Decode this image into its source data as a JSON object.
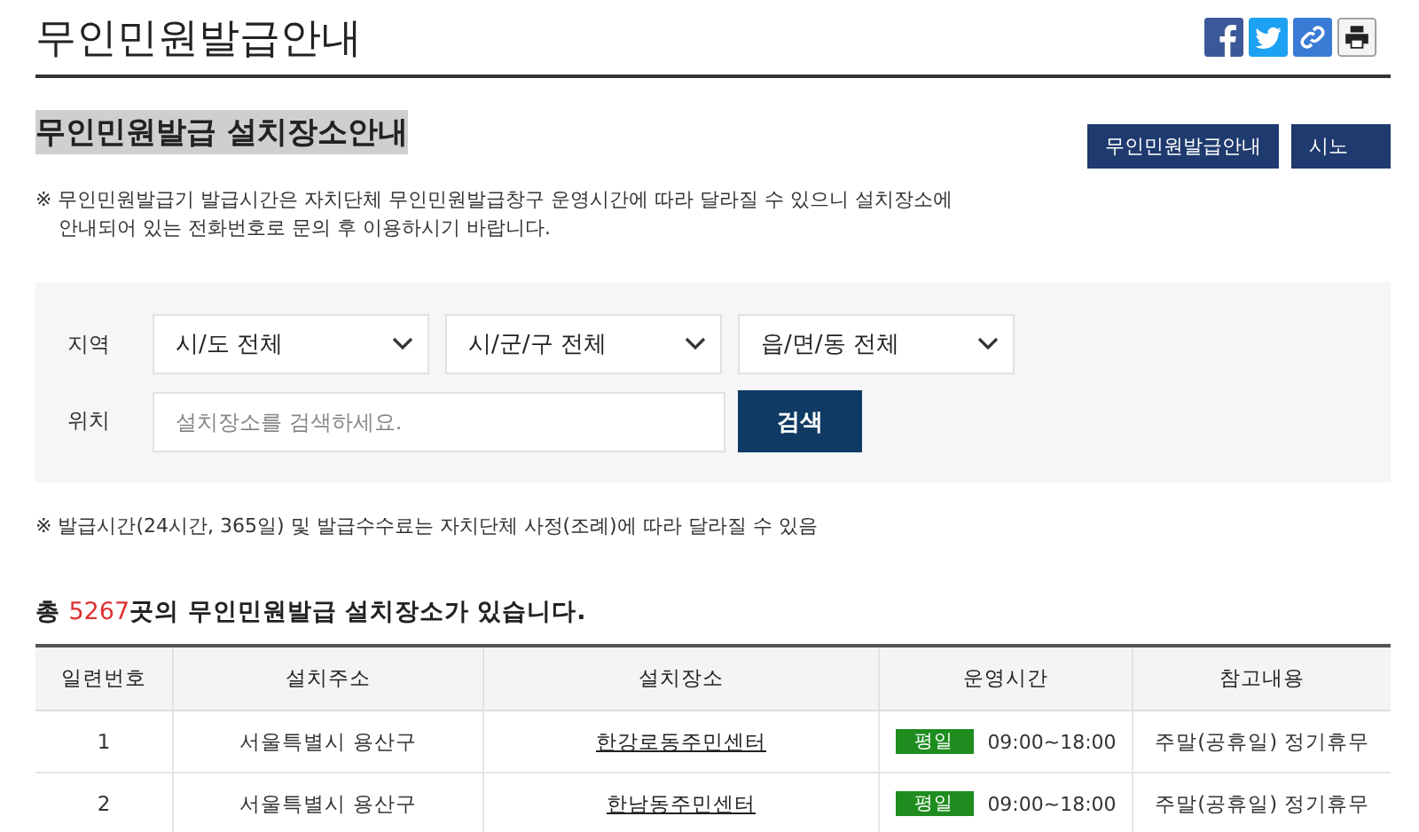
{
  "page_title": "무인민원발급안내",
  "share_icons": [
    {
      "kind": "facebook"
    },
    {
      "kind": "twitter"
    },
    {
      "kind": "link"
    },
    {
      "kind": "print"
    }
  ],
  "section_title": "무인민원발급 설치장소안내",
  "tab_buttons": [
    {
      "label": "무인민원발급안내",
      "selected": false
    },
    {
      "label": "시노",
      "selected": false
    }
  ],
  "notice": [
    "※ 무인민원발급기 발급시간은 자치단체 무인민원발급창구 운영시간에 따라 달라질 수 있으니 설치장소에",
    "안내되어 있는 전화번호로 문의 후 이용하시기 바랍니다."
  ],
  "search": {
    "region_label": "지역",
    "selects": [
      "시/도 전체",
      "시/군/구 전체",
      "읍/면/동 전체"
    ],
    "location_label": "위치",
    "placeholder": "설치장소를 검색하세요.",
    "button": "검색"
  },
  "footnote": "※ 발급시간(24시간, 365일) 및 발급수수료는 자치단체 사정(조례)에 따라 달라질 수 있음",
  "count": {
    "prefix": "총 ",
    "number": "5267",
    "suffix": "곳의 무인민원발급 설치장소가 있습니다."
  },
  "table": {
    "columns": [
      "일련번호",
      "설치주소",
      "설치장소",
      "운영시간",
      "참고내용"
    ],
    "rows": [
      {
        "no": "1",
        "address": "서울특별시 용산구",
        "place": "한강로동주민센터",
        "day": "평일",
        "hours": "09:00~18:00",
        "note": "주말(공휴일) 정기휴무"
      },
      {
        "no": "2",
        "address": "서울특별시 용산구",
        "place": "한남동주민센터",
        "day": "평일",
        "hours": "09:00~18:00",
        "note": "주말(공휴일) 정기휴무"
      }
    ]
  }
}
